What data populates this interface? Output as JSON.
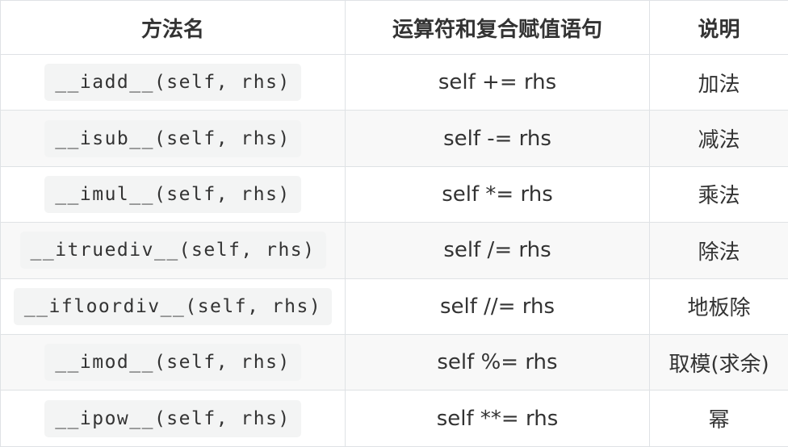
{
  "table": {
    "headers": [
      "方法名",
      "运算符和复合赋值语句",
      "说明"
    ],
    "rows": [
      {
        "method": "__iadd__(self, rhs)",
        "operator": "self += rhs",
        "desc": "加法"
      },
      {
        "method": "__isub__(self, rhs)",
        "operator": "self -= rhs",
        "desc": "减法"
      },
      {
        "method": "__imul__(self, rhs)",
        "operator": "self *= rhs",
        "desc": "乘法"
      },
      {
        "method": "__itruediv__(self, rhs)",
        "operator": "self /= rhs",
        "desc": "除法"
      },
      {
        "method": "__ifloordiv__(self, rhs)",
        "operator": "self //= rhs",
        "desc": "地板除"
      },
      {
        "method": "__imod__(self, rhs)",
        "operator": "self %= rhs",
        "desc": "取模(求余)"
      },
      {
        "method": "__ipow__(self, rhs)",
        "operator": "self **= rhs",
        "desc": "幂"
      }
    ]
  },
  "colors": {
    "border": "#dfe2e5",
    "stripe": "#f8f8f8",
    "code_background": "#f3f4f4",
    "text": "#333333"
  }
}
